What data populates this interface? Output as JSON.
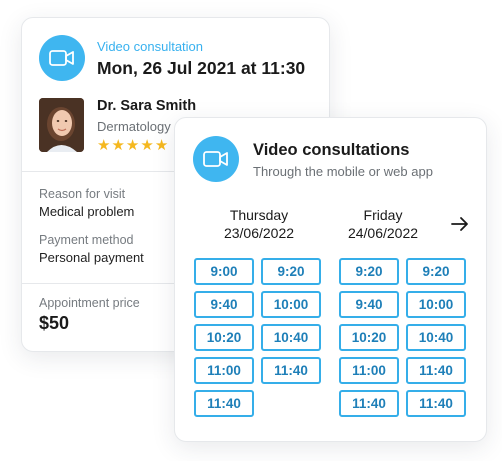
{
  "appointment": {
    "kind": "Video consultation",
    "datetime": "Mon, 26 Jul 2021 at 11:30",
    "doctor": {
      "name": "Dr. Sara Smith",
      "specialty": "Dermatology",
      "rating_stars": 5
    },
    "reason_label": "Reason for visit",
    "reason_value": "Medical problem",
    "payment_label": "Payment method",
    "payment_value": "Personal payment",
    "price_label": "Appointment price",
    "price_value": "$50"
  },
  "availability": {
    "title": "Video consultations",
    "subtitle": "Through the mobile or web app",
    "days": [
      {
        "weekday": "Thursday",
        "date": "23/06/2022",
        "slots": [
          "9:00",
          "9:20",
          "9:40",
          "10:00",
          "10:20",
          "10:40",
          "11:00",
          "11:40",
          "11:40"
        ]
      },
      {
        "weekday": "Friday",
        "date": "24/06/2022",
        "slots": [
          "9:20",
          "9:20",
          "9:40",
          "10:00",
          "10:20",
          "10:40",
          "11:00",
          "11:40",
          "11:40",
          "11:40"
        ]
      }
    ]
  },
  "colors": {
    "accent": "#3fb6f0",
    "star": "#f5b81f",
    "slot_text": "#1e7fb8"
  },
  "icons": {
    "video": "video-camera-icon",
    "next": "arrow-right-icon",
    "star": "star-icon"
  }
}
